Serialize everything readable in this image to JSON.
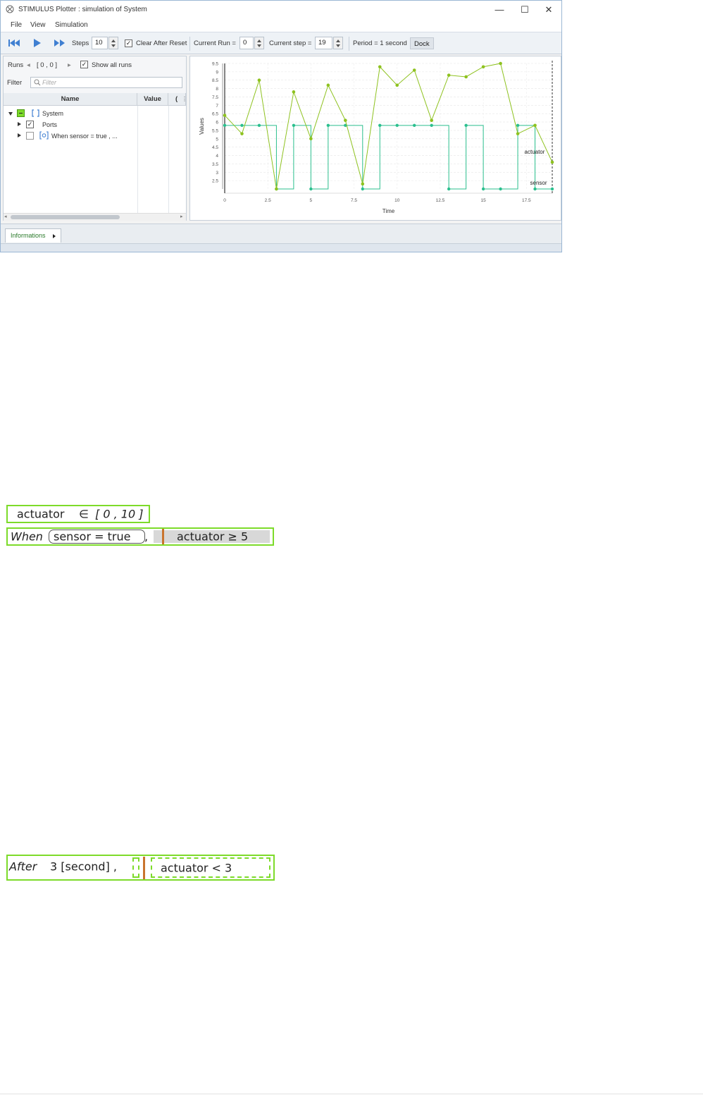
{
  "window": {
    "title": "STIMULUS Plotter : simulation of System",
    "controls": {
      "minimize": "—",
      "maximize": "☐",
      "close": "✕"
    }
  },
  "menu": [
    "File",
    "View",
    "Simulation"
  ],
  "toolbar": {
    "steps_label": "Steps",
    "steps_value": "10",
    "clear_after_reset_label": "Clear After Reset",
    "clear_after_reset_checked": true,
    "current_run_label": "Current Run =",
    "current_run_value": "0",
    "current_step_label": "Current step =",
    "current_step_value": "19",
    "period_label": "Period = 1 second",
    "dock_label": "Dock"
  },
  "runs": {
    "label": "Runs",
    "range": "[ 0 , 0 ]",
    "show_all_runs_label": "Show all runs",
    "show_all_runs_checked": true,
    "filter_label": "Filter",
    "filter_placeholder": "Filter"
  },
  "tree": {
    "columns": [
      "Name",
      "Value",
      "("
    ],
    "items": [
      {
        "label": "System"
      },
      {
        "label": "Ports"
      },
      {
        "label": "When  sensor =  true , ..."
      }
    ]
  },
  "bottom_tabs": {
    "informations_label": "Informations"
  },
  "colors": {
    "accent": "#8ec21f",
    "teal": "#2bbf8e",
    "req_border": "#7ddb2a",
    "req_bar": "#c9742e"
  },
  "chart_data": {
    "type": "line",
    "xlabel": "Time",
    "ylabel": "Values",
    "xlim": [
      0,
      19
    ],
    "ylim": [
      2,
      9.5
    ],
    "xticks": [
      "0",
      "2.5",
      "5",
      "7.5",
      "10",
      "12.5",
      "15",
      "17.5"
    ],
    "xtick_values": [
      0,
      2.5,
      5,
      7.5,
      10,
      12.5,
      15,
      17.5
    ],
    "yticks": [
      "2.5",
      "3",
      "3.5",
      "4",
      "4.5",
      "5",
      "5.5",
      "6",
      "6.5",
      "7",
      "7.5",
      "8",
      "8.5",
      "9",
      "9.5"
    ],
    "ytick_values": [
      2.5,
      3,
      3.5,
      4,
      4.5,
      5,
      5.5,
      6,
      6.5,
      7,
      7.5,
      8,
      8.5,
      9,
      9.5
    ],
    "grid": true,
    "series": [
      {
        "name": "actuator",
        "style": "line",
        "x": [
          0,
          1,
          2,
          3,
          4,
          5,
          6,
          7,
          8,
          9,
          10,
          11,
          12,
          13,
          14,
          15,
          16,
          17,
          18,
          19
        ],
        "values": [
          6.4,
          5.3,
          8.5,
          2.0,
          7.8,
          5.0,
          8.2,
          6.1,
          2.3,
          9.3,
          8.2,
          9.1,
          6.1,
          8.8,
          8.7,
          9.3,
          9.5,
          5.3,
          5.8,
          3.6
        ]
      },
      {
        "name": "sensor",
        "style": "step",
        "low": 2.0,
        "high": 5.8,
        "x": [
          0,
          1,
          2,
          3,
          4,
          5,
          6,
          7,
          8,
          9,
          10,
          11,
          12,
          13,
          14,
          15,
          16,
          17,
          18,
          19
        ],
        "values": [
          1,
          1,
          1,
          0,
          1,
          0,
          1,
          1,
          0,
          1,
          1,
          1,
          1,
          0,
          1,
          0,
          0,
          1,
          0,
          0
        ]
      }
    ]
  },
  "requirements": {
    "r1": {
      "var": "actuator",
      "op": "∈",
      "range": "[ 0 ,    10 ]"
    },
    "r2": {
      "kw": "When",
      "cond": "sensor   =   true",
      "comma": ",",
      "post": "actuator   ≥   5"
    },
    "r3": {
      "kw": "After",
      "dur": "3 [second] ,",
      "post": "actuator   <   3"
    }
  }
}
